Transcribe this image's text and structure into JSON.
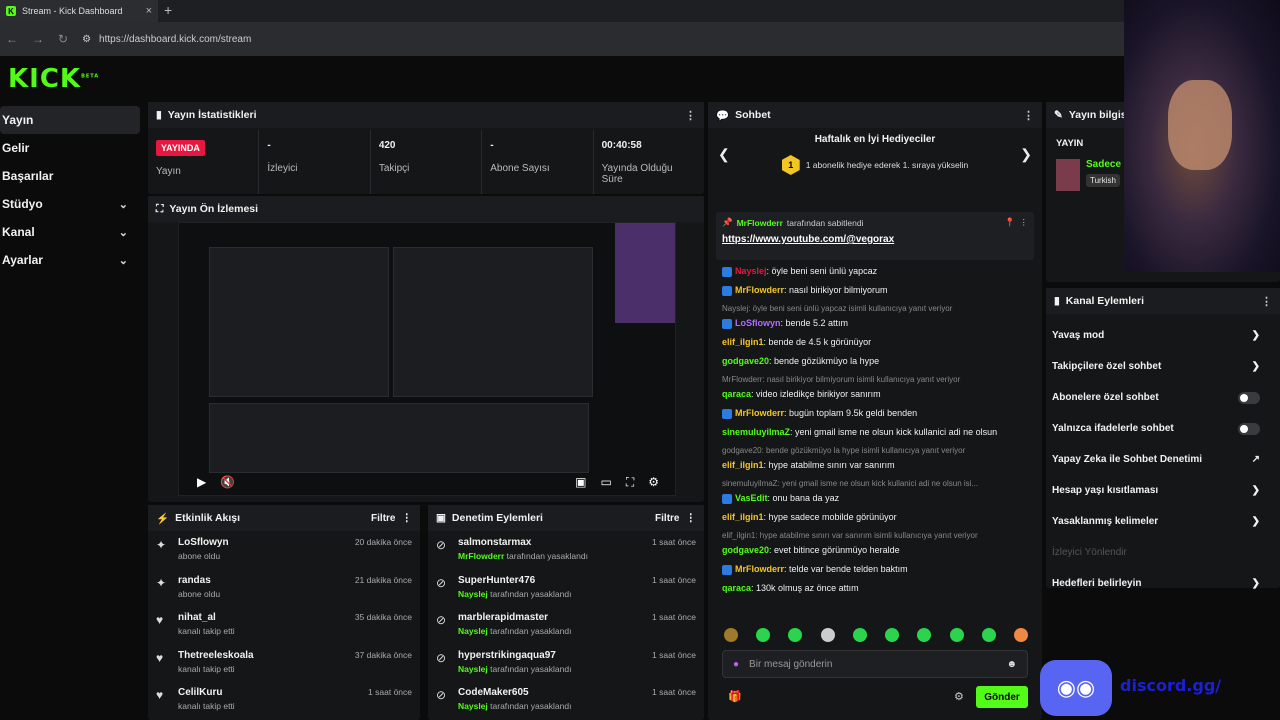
{
  "browser": {
    "tab_title": "Stream - Kick Dashboard",
    "tab_icon": "K",
    "url": "https://dashboard.kick.com/stream",
    "new_tab": "+",
    "close": "×"
  },
  "logo": {
    "text": "KICK",
    "sup": "BETA"
  },
  "sidebar": {
    "items": [
      {
        "label": "Yayın",
        "active": true,
        "expandable": false
      },
      {
        "label": "Gelir",
        "active": false,
        "expandable": false
      },
      {
        "label": "Başarılar",
        "active": false,
        "expandable": false
      },
      {
        "label": "Stüdyo",
        "active": false,
        "expandable": true
      },
      {
        "label": "Kanal",
        "active": false,
        "expandable": true
      },
      {
        "label": "Ayarlar",
        "active": false,
        "expandable": true
      }
    ]
  },
  "stats": {
    "title": "Yayın İstatistikleri",
    "items": [
      {
        "value": "YAYINDA",
        "label": "Yayın"
      },
      {
        "value": "-",
        "label": "İzleyici"
      },
      {
        "value": "420",
        "label": "Takipçi"
      },
      {
        "value": "-",
        "label": "Abone Sayısı"
      },
      {
        "value": "00:40:58",
        "label": "Yayında Olduğu Süre"
      }
    ]
  },
  "preview": {
    "title": "Yayın Ön İzlemesi"
  },
  "activity": {
    "title": "Etkinlik Akışı",
    "filter": "Filtre",
    "items": [
      {
        "name": "LoSflowyn",
        "sub": "abone oldu",
        "time": "20 dakika önce",
        "icon": "star-icon"
      },
      {
        "name": "randas",
        "sub": "abone oldu",
        "time": "21 dakika önce",
        "icon": "star-icon"
      },
      {
        "name": "nihat_al",
        "sub": "kanalı takip etti",
        "time": "35 dakika önce",
        "icon": "heart-icon"
      },
      {
        "name": "Thetreeleskoala",
        "sub": "kanalı takip etti",
        "time": "37 dakika önce",
        "icon": "heart-icon"
      },
      {
        "name": "CelilKuru",
        "sub": "kanalı takip etti",
        "time": "1 saat önce",
        "icon": "heart-icon"
      }
    ]
  },
  "moderation": {
    "title": "Denetim Eylemleri",
    "filter": "Filtre",
    "items": [
      {
        "name": "salmonstarmax",
        "by": "MrFlowderr",
        "sub": "tarafından yasaklandı",
        "time": "1 saat önce"
      },
      {
        "name": "SuperHunter476",
        "by": "Nayslej",
        "sub": "tarafından yasaklandı",
        "time": "1 saat önce"
      },
      {
        "name": "marblerapidmaster",
        "by": "Nayslej",
        "sub": "tarafından yasaklandı",
        "time": "1 saat önce"
      },
      {
        "name": "hyperstrikingaqua97",
        "by": "Nayslej",
        "sub": "tarafından yasaklandı",
        "time": "1 saat önce"
      },
      {
        "name": "CodeMaker605",
        "by": "Nayslej",
        "sub": "tarafından yasaklandı",
        "time": "1 saat önce"
      }
    ]
  },
  "chat": {
    "title": "Sohbet",
    "gift_title": "Haftalık en İyi Hediyeciler",
    "gift_rank": "1",
    "gift_text": "1 abonelik hediye ederek 1. sıraya yükselin",
    "pinned_by": "MrFlowderr",
    "pinned_suffix": "tarafından sabitlendi",
    "pinned_link": "https://www.youtube.com/@vegorax",
    "messages": [
      {
        "type": "msg",
        "user": "Nayslej",
        "color": "#e6183f",
        "badge": true,
        "text": ": öyle beni seni ünlü yapcaz"
      },
      {
        "type": "msg",
        "user": "MrFlowderr",
        "color": "#f3c624",
        "badge": true,
        "text": ": nasıl birikiyor bilmiyorum"
      },
      {
        "type": "reply",
        "text": "Nayslej: öyle beni seni ünlü yapcaz isimli kullanıcıya yanıt veriyor"
      },
      {
        "type": "msg",
        "user": "LoSflowyn",
        "color": "#b36bff",
        "badge": true,
        "text": ": bende 5.2 attım"
      },
      {
        "type": "msg",
        "user": "elif_ilgin1",
        "color": "#f3c624",
        "badge": false,
        "text": ": bende de 4.5 k görünüyor"
      },
      {
        "type": "msg",
        "user": "godgave20",
        "color": "#53fc18",
        "badge": false,
        "text": ": bende gözükmüyo la hype"
      },
      {
        "type": "reply",
        "text": "MrFlowderr: nasıl birikiyor bilmiyorum isimli kullanıcıya yanıt veriyor"
      },
      {
        "type": "msg",
        "user": "qaraca",
        "color": "#53fc18",
        "badge": false,
        "text": ": video izledikçe birikiyor sanırım"
      },
      {
        "type": "msg",
        "user": "MrFlowderr",
        "color": "#f3c624",
        "badge": true,
        "text": ": bugün toplam 9.5k geldi benden"
      },
      {
        "type": "msg",
        "user": "sinemuluyilmaZ",
        "color": "#53fc18",
        "badge": false,
        "text": ": yeni gmail isme ne olsun kick kullanici adi ne olsun"
      },
      {
        "type": "reply",
        "text": "godgave20: bende gözükmüyo la hype isimli kullanıcıya yanıt veriyor"
      },
      {
        "type": "msg",
        "user": "elif_ilgin1",
        "color": "#f3c624",
        "badge": false,
        "text": ": hype atabilme sınırı var sanırım"
      },
      {
        "type": "reply",
        "text": "sinemuluyilmaZ: yeni gmail isme ne olsun kick kullanici adi ne olsun isi..."
      },
      {
        "type": "msg",
        "user": "VasEdit",
        "color": "#53fc18",
        "badge": true,
        "text": ": onu bana da yaz"
      },
      {
        "type": "msg",
        "user": "elif_ilgin1",
        "color": "#f3c624",
        "badge": false,
        "text": ": hype sadece mobilde görünüyor"
      },
      {
        "type": "reply",
        "text": "elif_ilgin1: hype atabilme sınırı var sanırım isimli kullanıcıya yanıt veriyor"
      },
      {
        "type": "msg",
        "user": "godgave20",
        "color": "#53fc18",
        "badge": false,
        "text": ": evet bitince görünmüyo heralde"
      },
      {
        "type": "msg",
        "user": "MrFlowderr",
        "color": "#f3c624",
        "badge": true,
        "text": ": telde var bende telden baktım"
      },
      {
        "type": "msg",
        "user": "qaraca",
        "color": "#53fc18",
        "badge": false,
        "text": ": 130k olmuş az önce attım"
      }
    ],
    "input_placeholder": "Bir mesaj gönderin",
    "send_label": "Gönder"
  },
  "streaminfo": {
    "title": "Yayın bilgisi",
    "status": "YAYIN",
    "name": "Sadece",
    "tag": "Turkish"
  },
  "channel_actions": {
    "title": "Kanal Eylemleri",
    "items": [
      {
        "label": "Yavaş mod",
        "control": "chevron"
      },
      {
        "label": "Takipçilere özel sohbet",
        "control": "chevron"
      },
      {
        "label": "Abonelere özel sohbet",
        "control": "toggle"
      },
      {
        "label": "Yalnızca ifadelerle sohbet",
        "control": "toggle"
      },
      {
        "label": "Yapay Zeka ile Sohbet Denetimi",
        "control": "external"
      },
      {
        "label": "Hesap yaşı kısıtlaması",
        "control": "chevron"
      },
      {
        "label": "Yasaklanmış kelimeler",
        "control": "chevron"
      },
      {
        "label": "İzleyici Yönlendir",
        "control": "none",
        "disabled": true
      },
      {
        "label": "Hedefleri belirleyin",
        "control": "chevron"
      }
    ]
  },
  "colors": {
    "accent": "#53fc18",
    "live": "#e6183f"
  }
}
